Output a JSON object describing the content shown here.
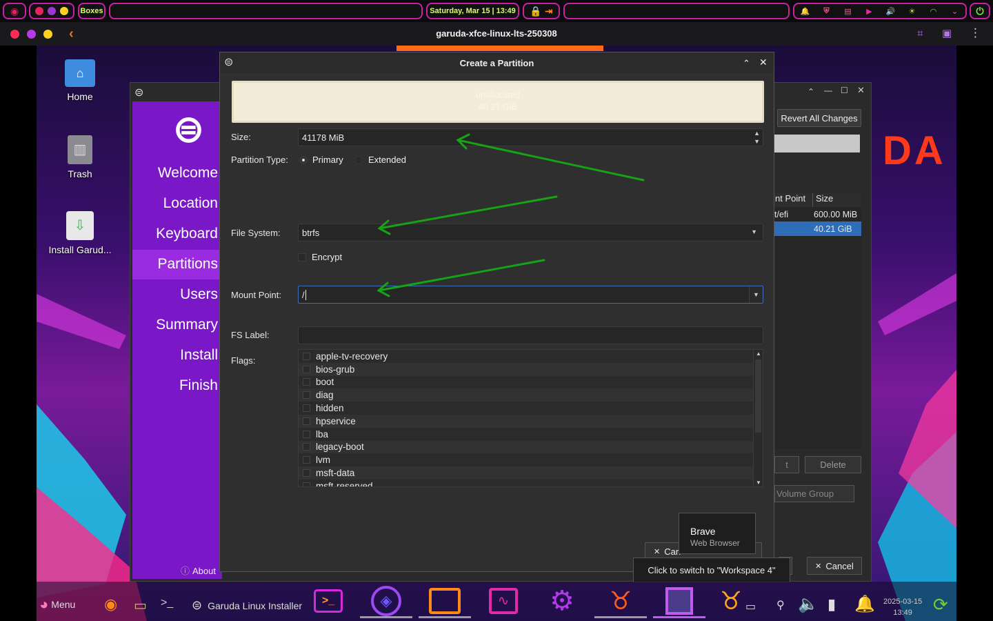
{
  "top_panel": {
    "boxes_label": "Boxes",
    "clock": "Saturday, Mar 15 | 13:49",
    "accent": "#cc1fa8"
  },
  "vm_window": {
    "title": "garuda-xfce-linux-lts-250308"
  },
  "desktop_icons": [
    {
      "label": "Home"
    },
    {
      "label": "Trash"
    },
    {
      "label": "Install Garud..."
    }
  ],
  "installer_sidebar": {
    "steps": [
      "Welcome",
      "Location",
      "Keyboard",
      "Partitions",
      "Users",
      "Summary",
      "Install",
      "Finish"
    ],
    "active_index": 3,
    "about": "About"
  },
  "background_partition_page": {
    "revert_button": "Revert All Changes",
    "table_headers": [
      "nt Point",
      "Size"
    ],
    "rows": [
      {
        "mount": "t/efi",
        "size": "600.00 MiB"
      },
      {
        "mount": "",
        "size": "40.21 GiB"
      }
    ],
    "edit_button": "t",
    "delete_button": "Delete",
    "volume_group_button": "Volume Group",
    "cancel_button": "Cancel",
    "brand_text": "DA"
  },
  "dialog": {
    "title": "Create a Partition",
    "partition_bar": {
      "label": "unallocated",
      "size": "40.21 GiB"
    },
    "size_label": "Size:",
    "size_value": "41178 MiB",
    "partition_type_label": "Partition Type:",
    "partition_type_options": [
      "Primary",
      "Extended"
    ],
    "file_system_label": "File System:",
    "file_system_value": "btrfs",
    "encrypt_label": "Encrypt",
    "mount_point_label": "Mount Point:",
    "mount_point_value": "/",
    "fs_label_label": "FS Label:",
    "fs_label_value": "",
    "flags_label": "Flags:",
    "flags": [
      "apple-tv-recovery",
      "bios-grub",
      "boot",
      "diag",
      "hidden",
      "hpservice",
      "lba",
      "legacy-boot",
      "lvm",
      "msft-data",
      "msft-reserved"
    ],
    "cancel_button": "Can"
  },
  "tooltip_brave": {
    "title": "Brave",
    "subtitle": "Web Browser"
  },
  "tooltip_workspace": "Click to switch to \"Workspace 4\"",
  "taskbar": {
    "menu_label": "Menu",
    "active_task": "Garuda Linux Installer",
    "date": "2025-03-15",
    "time": "13:49"
  }
}
